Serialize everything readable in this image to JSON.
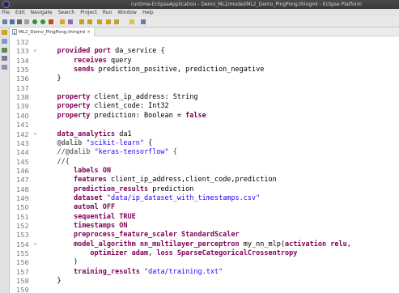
{
  "window": {
    "title": "runtime-EclipseApplication - Demo_ML2/model/ML2_Demo_PingPong.thingml - Eclipse Platform"
  },
  "menubar": {
    "items": [
      "File",
      "Edit",
      "Navigate",
      "Search",
      "Project",
      "Run",
      "Window",
      "Help"
    ]
  },
  "editor": {
    "tab_label": "ML2_Demo_PingPong.thingml",
    "close_glyph": "✕"
  },
  "code": {
    "lines": [
      {
        "n": "132",
        "fold": false,
        "segs": []
      },
      {
        "n": "133",
        "fold": true,
        "segs": [
          {
            "t": "    "
          },
          {
            "t": "provided",
            "c": "kw"
          },
          {
            "t": " "
          },
          {
            "t": "port",
            "c": "kw"
          },
          {
            "t": " da_service {"
          }
        ]
      },
      {
        "n": "134",
        "fold": false,
        "segs": [
          {
            "t": "        "
          },
          {
            "t": "receives",
            "c": "kw"
          },
          {
            "t": " query"
          }
        ]
      },
      {
        "n": "135",
        "fold": false,
        "segs": [
          {
            "t": "        "
          },
          {
            "t": "sends",
            "c": "kw"
          },
          {
            "t": " prediction_positive, prediction_negative"
          }
        ]
      },
      {
        "n": "136",
        "fold": false,
        "segs": [
          {
            "t": "    }"
          }
        ]
      },
      {
        "n": "137",
        "fold": false,
        "segs": []
      },
      {
        "n": "138",
        "fold": false,
        "segs": [
          {
            "t": "    "
          },
          {
            "t": "property",
            "c": "kw"
          },
          {
            "t": " client_ip_address: String"
          }
        ]
      },
      {
        "n": "139",
        "fold": false,
        "segs": [
          {
            "t": "    "
          },
          {
            "t": "property",
            "c": "kw"
          },
          {
            "t": " client_code: Int32"
          }
        ]
      },
      {
        "n": "140",
        "fold": false,
        "segs": [
          {
            "t": "    "
          },
          {
            "t": "property",
            "c": "kw"
          },
          {
            "t": " prediction: Boolean = "
          },
          {
            "t": "false",
            "c": "kw"
          }
        ]
      },
      {
        "n": "141",
        "fold": false,
        "segs": []
      },
      {
        "n": "142",
        "fold": true,
        "segs": [
          {
            "t": "    "
          },
          {
            "t": "data_analytics",
            "c": "kw"
          },
          {
            "t": " da1"
          }
        ]
      },
      {
        "n": "143",
        "fold": false,
        "segs": [
          {
            "t": "    "
          },
          {
            "t": "@dalib",
            "c": "anno"
          },
          {
            "t": " "
          },
          {
            "t": "\"scikit-learn\"",
            "c": "str"
          },
          {
            "t": " {"
          }
        ]
      },
      {
        "n": "144",
        "fold": false,
        "segs": [
          {
            "t": "    //@dalib ",
            "c": "comment"
          },
          {
            "t": "\"keras-tensorflow\"",
            "c": "str"
          },
          {
            "t": " {",
            "c": "comment"
          }
        ]
      },
      {
        "n": "145",
        "fold": false,
        "segs": [
          {
            "t": "    //{",
            "c": "comment"
          }
        ]
      },
      {
        "n": "146",
        "fold": false,
        "segs": [
          {
            "t": "        "
          },
          {
            "t": "labels ON",
            "c": "kw"
          }
        ]
      },
      {
        "n": "147",
        "fold": false,
        "segs": [
          {
            "t": "        "
          },
          {
            "t": "features",
            "c": "kw"
          },
          {
            "t": " client_ip_address,client_code,prediction"
          }
        ]
      },
      {
        "n": "148",
        "fold": false,
        "segs": [
          {
            "t": "        "
          },
          {
            "t": "prediction_results",
            "c": "kw"
          },
          {
            "t": " prediction"
          }
        ]
      },
      {
        "n": "149",
        "fold": false,
        "segs": [
          {
            "t": "        "
          },
          {
            "t": "dataset",
            "c": "kw"
          },
          {
            "t": " "
          },
          {
            "t": "\"data/ip_dataset_with_timestamps.csv\"",
            "c": "str"
          }
        ]
      },
      {
        "n": "150",
        "fold": false,
        "segs": [
          {
            "t": "        "
          },
          {
            "t": "automl OFF",
            "c": "kw"
          }
        ]
      },
      {
        "n": "151",
        "fold": false,
        "segs": [
          {
            "t": "        "
          },
          {
            "t": "sequential TRUE",
            "c": "kw"
          }
        ]
      },
      {
        "n": "152",
        "fold": false,
        "segs": [
          {
            "t": "        "
          },
          {
            "t": "timestamps ON",
            "c": "kw"
          }
        ]
      },
      {
        "n": "153",
        "fold": false,
        "segs": [
          {
            "t": "        "
          },
          {
            "t": "preprocess_feature_scaler StandardScaler",
            "c": "kw"
          }
        ]
      },
      {
        "n": "154",
        "fold": true,
        "segs": [
          {
            "t": "        "
          },
          {
            "t": "model_algorithm nn_multilayer_perceptron",
            "c": "kw"
          },
          {
            "t": " my_nn_mlp("
          },
          {
            "t": "activation relu",
            "c": "kw"
          },
          {
            "t": ","
          }
        ]
      },
      {
        "n": "155",
        "fold": false,
        "segs": [
          {
            "t": "            "
          },
          {
            "t": "optimizer adam",
            "c": "kw"
          },
          {
            "t": ", "
          },
          {
            "t": "loss SparseCategoricalCrossentropy",
            "c": "kw"
          }
        ]
      },
      {
        "n": "156",
        "fold": false,
        "segs": [
          {
            "t": "        )"
          }
        ]
      },
      {
        "n": "157",
        "fold": false,
        "segs": [
          {
            "t": "        "
          },
          {
            "t": "training_results",
            "c": "kw"
          },
          {
            "t": " "
          },
          {
            "t": "\"data/training.txt\"",
            "c": "str"
          }
        ]
      },
      {
        "n": "158",
        "fold": false,
        "segs": [
          {
            "t": "    }"
          }
        ]
      },
      {
        "n": "159",
        "fold": false,
        "segs": []
      }
    ]
  },
  "colors": {
    "keyword": "#7f0055",
    "string": "#2a00ff",
    "annotation": "#646464",
    "line_number": "#787878"
  }
}
